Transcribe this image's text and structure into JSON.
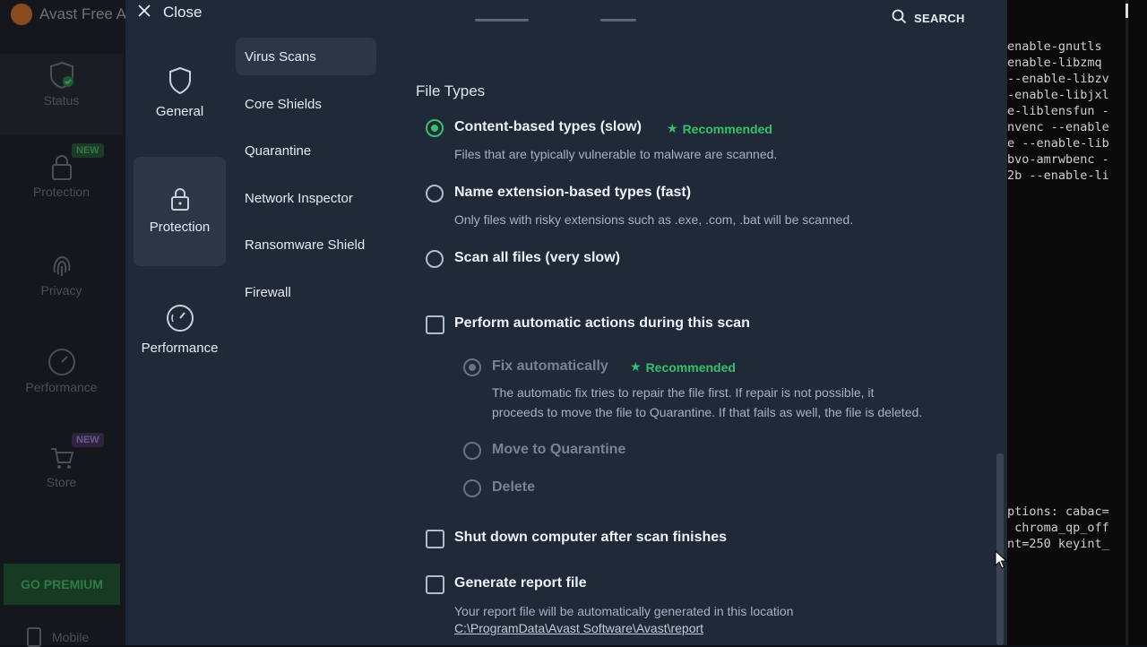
{
  "background_app": {
    "title": "Avast Free A",
    "nav": [
      {
        "label": "Status",
        "icon": "shield-check-icon"
      },
      {
        "label": "Protection",
        "icon": "lock-icon",
        "badge": "NEW"
      },
      {
        "label": "Privacy",
        "icon": "fingerprint-icon"
      },
      {
        "label": "Performance",
        "icon": "speedometer-icon"
      },
      {
        "label": "Store",
        "icon": "cart-icon",
        "badge": "NEW"
      }
    ],
    "premium_button": "GO PREMIUM",
    "mobile_label": "Mobile"
  },
  "terminal": {
    "lines_top": [
      "enable-gnutls",
      "enable-libzmq",
      "--enable-libzv",
      "-enable-libjxl",
      "e-liblensfun -",
      "nvenc --enable",
      "e --enable-lib",
      "bvo-amrwbenc -",
      "2b --enable-li"
    ],
    "lines_bottom": [
      "ptions: cabac=",
      " chroma_qp_off",
      "nt=250 keyint_"
    ]
  },
  "dialog": {
    "close_label": "Close",
    "search_label": "SEARCH",
    "categories": [
      {
        "label": "General",
        "icon": "shield-icon"
      },
      {
        "label": "Protection",
        "icon": "lock-icon"
      },
      {
        "label": "Performance",
        "icon": "speedometer-icon"
      }
    ],
    "subnav": [
      "Virus Scans",
      "Core Shields",
      "Quarantine",
      "Network Inspector",
      "Ransomware Shield",
      "Firewall"
    ],
    "file_types": {
      "title": "File Types",
      "options": [
        {
          "label": "Content-based types (slow)",
          "recommended": "Recommended",
          "desc": "Files that are typically vulnerable to malware are scanned.",
          "selected": true
        },
        {
          "label": "Name extension-based types (fast)",
          "desc": "Only files with risky extensions such as .exe, .com, .bat will be scanned.",
          "selected": false
        },
        {
          "label": "Scan all files (very slow)",
          "selected": false
        }
      ]
    },
    "auto_actions": {
      "label": "Perform automatic actions during this scan",
      "checked": false,
      "options": [
        {
          "label": "Fix automatically",
          "recommended": "Recommended",
          "desc_line1": "The automatic fix tries to repair the file first. If repair is not possible, it",
          "desc_line2": "proceeds to move the file to Quarantine. If that fails as well, the file is deleted.",
          "selected": true
        },
        {
          "label": "Move to Quarantine",
          "selected": false
        },
        {
          "label": "Delete",
          "selected": false
        }
      ]
    },
    "shutdown": {
      "label": "Shut down computer after scan finishes",
      "checked": false
    },
    "report": {
      "label": "Generate report file",
      "checked": false,
      "desc": "Your report file will be automatically generated in this location",
      "path": "C:\\ProgramData\\Avast Software\\Avast\\report"
    }
  }
}
